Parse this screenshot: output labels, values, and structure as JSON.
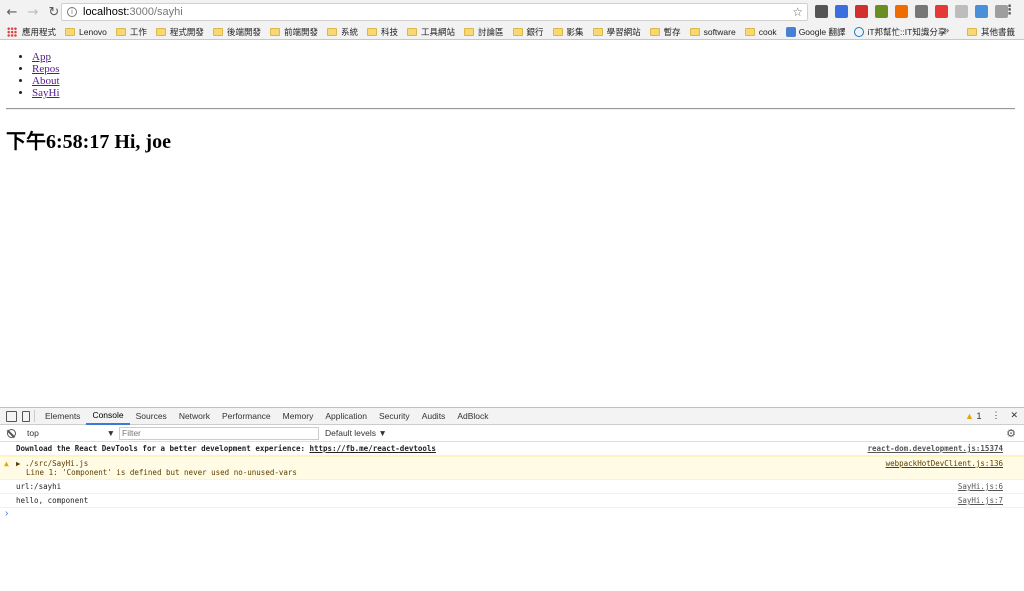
{
  "browser": {
    "url_host": "localhost:",
    "url_path": "3000/sayhi",
    "bookmarks": [
      "應用程式",
      "Lenovo",
      "工作",
      "程式開發",
      "後端開發",
      "前端開發",
      "系統",
      "科技",
      "工具網站",
      "討論區",
      "銀行",
      "影集",
      "學習網站",
      "暫存",
      "software",
      "cook",
      "Google 翻譯",
      "iT邦幫忙::IT知識分享"
    ],
    "bookmarks_more": "»",
    "bookmarks_other": "其他書籤",
    "ext_colors": [
      "#555555",
      "#3b6fe0",
      "#d32f2f",
      "#6b8e23",
      "#ef6c00",
      "#777777",
      "#e53935",
      "#bdbdbd",
      "#4a90d9",
      "#9e9e9e"
    ]
  },
  "page": {
    "nav": [
      "App",
      "Repos",
      "About",
      "SayHi"
    ],
    "greeting": "下午6:58:17 Hi, joe"
  },
  "devtools": {
    "tabs": [
      "Elements",
      "Console",
      "Sources",
      "Network",
      "Performance",
      "Memory",
      "Application",
      "Security",
      "Audits",
      "AdBlock"
    ],
    "active_tab": "Console",
    "warn_count": "1",
    "context": "top",
    "filter_placeholder": "Filter",
    "levels": "Default levels ▼",
    "messages": {
      "devtools_prefix": "Download the React DevTools for a better development experience: ",
      "devtools_link": "https://fb.me/react-devtools",
      "devtools_src": "react-dom.development.js:15374",
      "warn_file": "▶ ./src/SayHi.js",
      "warn_detail": "Line 1:  'Component' is defined but never used  no-unused-vars",
      "warn_src": "webpackHotDevClient.js:136",
      "log1": "url:/sayhi",
      "log1_src": "SayHi.js:6",
      "log2": "hello, component",
      "log2_src": "SayHi.js:7"
    }
  }
}
